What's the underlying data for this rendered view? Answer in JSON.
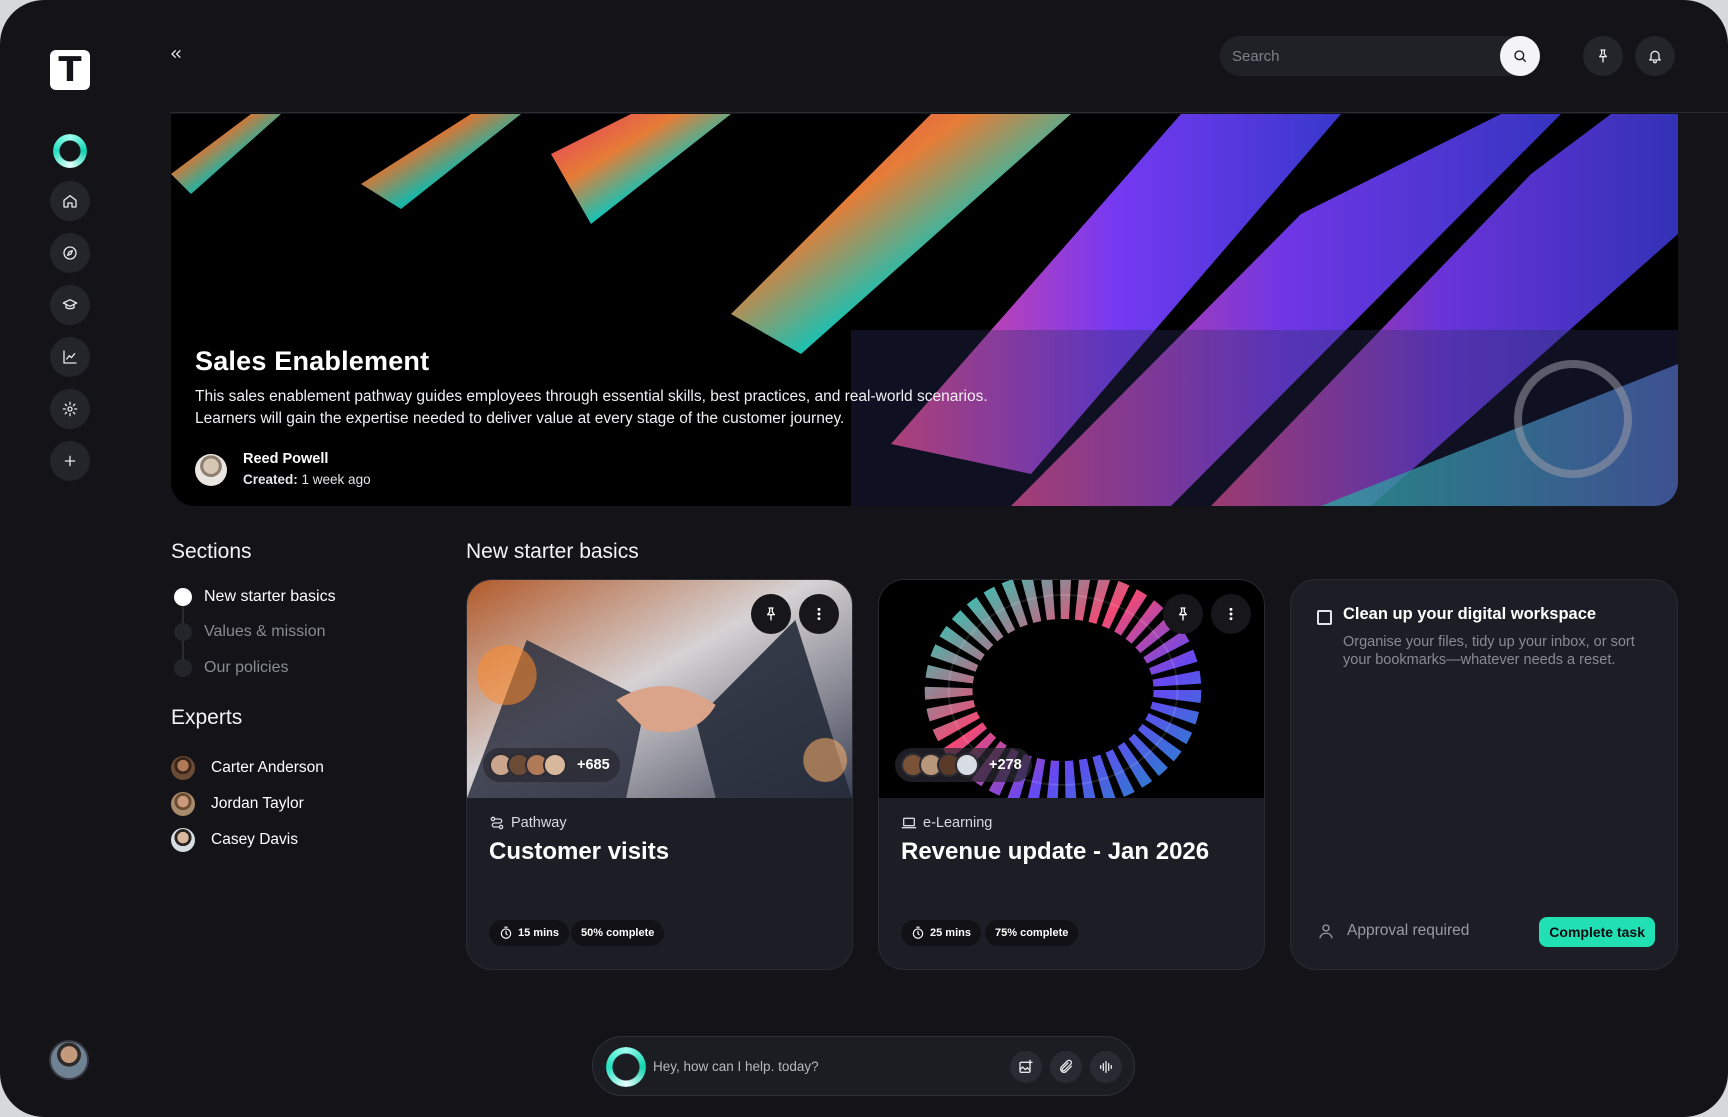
{
  "colors": {
    "background": "#131318",
    "card": "#1d1d25",
    "accent": "#20e0b4"
  },
  "sidebar": {
    "logo_letter": "T",
    "nav": [
      {
        "icon": "home-icon"
      },
      {
        "icon": "compass-icon"
      },
      {
        "icon": "graduation-cap-icon"
      },
      {
        "icon": "chart-icon"
      },
      {
        "icon": "gear-icon"
      },
      {
        "icon": "plus-icon"
      }
    ]
  },
  "topbar": {
    "search_placeholder": "Search"
  },
  "hero": {
    "title": "Sales Enablement",
    "description_line1": "This sales enablement pathway guides employees through essential skills, best practices, and real-world scenarios.",
    "description_line2": "Learners will gain the expertise needed to deliver value at every stage of the customer journey.",
    "author": "Reed Powell",
    "created_label": "Created:",
    "created_value": "1 week ago"
  },
  "sections": {
    "heading": "Sections",
    "items": [
      {
        "label": "New starter basics",
        "active": true
      },
      {
        "label": "Values & mission",
        "active": false
      },
      {
        "label": "Our policies",
        "active": false
      }
    ]
  },
  "experts": {
    "heading": "Experts",
    "items": [
      {
        "name": "Carter Anderson"
      },
      {
        "name": "Jordan Taylor"
      },
      {
        "name": "Casey Davis"
      }
    ]
  },
  "content": {
    "heading": "New starter basics",
    "cards": [
      {
        "type": "Pathway",
        "title": "Customer visits",
        "count": "+685",
        "duration": "15 mins",
        "progress_label": "50% complete",
        "progress": 0.5
      },
      {
        "type": "e-Learning",
        "title": "Revenue update - Jan 2026",
        "count": "+278",
        "duration": "25 mins",
        "progress_label": "75% complete",
        "progress": 0.75
      }
    ],
    "task": {
      "title": "Clean up your digital workspace",
      "description": "Organise your files, tidy up your inbox, or sort your bookmarks—whatever needs a reset.",
      "approval": "Approval required",
      "button": "Complete task"
    }
  },
  "chat": {
    "placeholder": "Hey, how can I help. today?"
  }
}
